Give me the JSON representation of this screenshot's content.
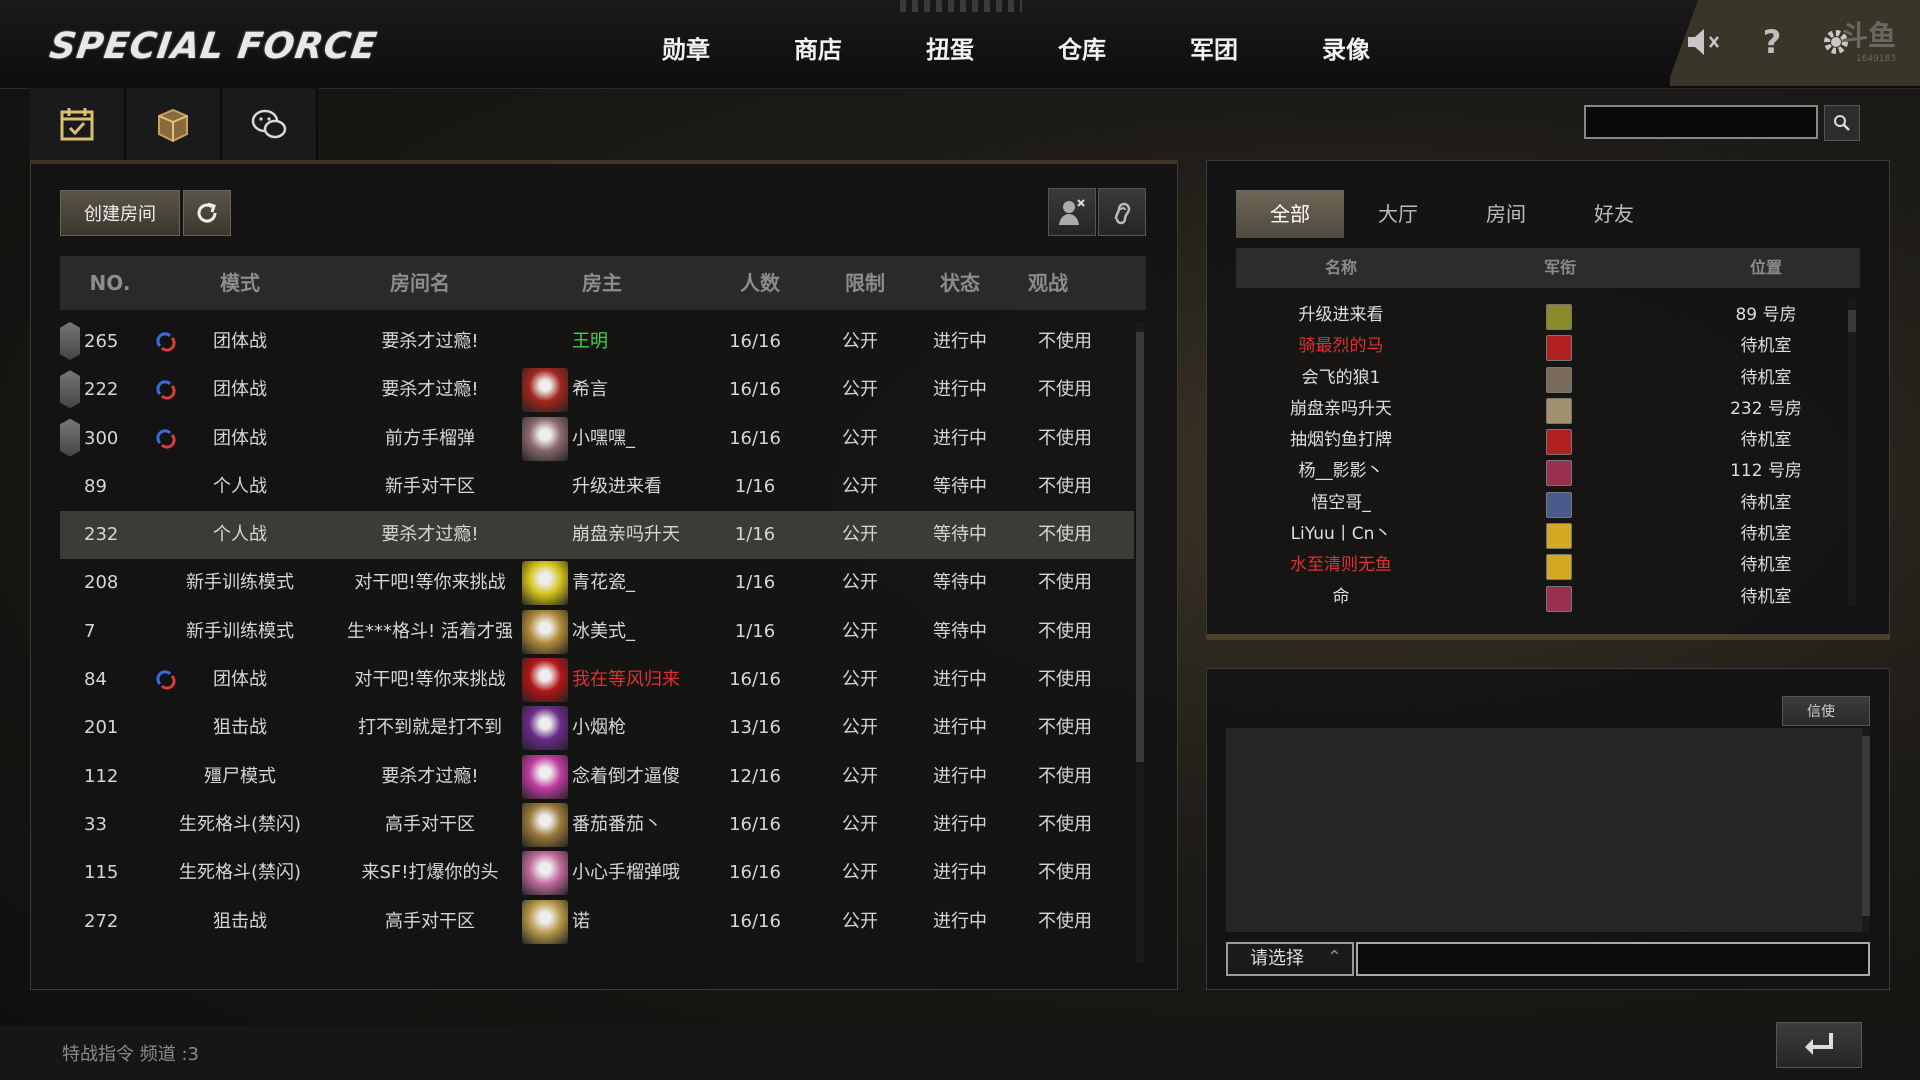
{
  "logo": "SPECIAL FORCE",
  "nav": [
    "勋章",
    "商店",
    "扭蛋",
    "仓库",
    "军团",
    "录像"
  ],
  "top_icons": [
    "speaker-muted-icon",
    "help-icon",
    "gear-icon"
  ],
  "watermark": {
    "text": "斗鱼",
    "id": "1649183"
  },
  "sub_icons": [
    "calendar-check-icon",
    "gift-box-icon",
    "wechat-icon"
  ],
  "search": {
    "value": ""
  },
  "room_panel": {
    "create_label": "创建房间",
    "headers": {
      "no": "NO.",
      "mode": "模式",
      "name": "房间名",
      "host": "房主",
      "people": "人数",
      "limit": "限制",
      "status": "状态",
      "observe": "观战"
    },
    "rows": [
      {
        "no": "265",
        "badge": true,
        "mode_icon": true,
        "mode": "团体战",
        "name": "要杀才过瘾!",
        "avatar": false,
        "host": "王明",
        "host_color": "green",
        "people": "16/16",
        "limit": "公开",
        "status": "进行中",
        "observe": "不使用"
      },
      {
        "no": "222",
        "badge": true,
        "mode_icon": true,
        "mode": "团体战",
        "name": "要杀才过瘾!",
        "avatar": "#a0261c",
        "host": "希言",
        "host_color": "",
        "people": "16/16",
        "limit": "公开",
        "status": "进行中",
        "observe": "不使用"
      },
      {
        "no": "300",
        "badge": true,
        "mode_icon": true,
        "mode": "团体战",
        "name": "前方手榴弹",
        "avatar": "#8a6a70",
        "host": "小嘿嘿_",
        "host_color": "",
        "people": "16/16",
        "limit": "公开",
        "status": "进行中",
        "observe": "不使用"
      },
      {
        "no": "89",
        "badge": false,
        "mode_icon": false,
        "mode": "个人战",
        "name": "新手对干区",
        "avatar": false,
        "host": "升级进来看",
        "host_color": "",
        "people": "1/16",
        "limit": "公开",
        "status": "等待中",
        "observe": "不使用"
      },
      {
        "no": "232",
        "badge": false,
        "mode_icon": false,
        "mode": "个人战",
        "name": "要杀才过瘾!",
        "avatar": false,
        "host": "崩盘亲吗升天",
        "host_color": "",
        "people": "1/16",
        "limit": "公开",
        "status": "等待中",
        "observe": "不使用",
        "selected": true
      },
      {
        "no": "208",
        "badge": false,
        "mode_icon": false,
        "mode": "新手训练模式",
        "name": "对干吧!等你来挑战",
        "avatar": "#d4c21a",
        "host": "青花瓷_",
        "host_color": "",
        "people": "1/16",
        "limit": "公开",
        "status": "等待中",
        "observe": "不使用"
      },
      {
        "no": "7",
        "badge": false,
        "mode_icon": false,
        "mode": "新手训练模式",
        "name": "生***格斗! 活着才强",
        "avatar": "#b08a3a",
        "host": "冰美式_",
        "host_color": "",
        "people": "1/16",
        "limit": "公开",
        "status": "等待中",
        "observe": "不使用"
      },
      {
        "no": "84",
        "badge": false,
        "mode_icon": true,
        "mode": "团体战",
        "name": "对干吧!等你来挑战",
        "avatar": "#b21616",
        "host": "我在等风归来",
        "host_color": "red",
        "people": "16/16",
        "limit": "公开",
        "status": "进行中",
        "observe": "不使用"
      },
      {
        "no": "201",
        "badge": false,
        "mode_icon": false,
        "mode": "狙击战",
        "name": "打不到就是打不到",
        "avatar": "#6a2a8a",
        "host": "小烟枪",
        "host_color": "",
        "people": "13/16",
        "limit": "公开",
        "status": "进行中",
        "observe": "不使用"
      },
      {
        "no": "112",
        "badge": false,
        "mode_icon": false,
        "mode": "殭尸模式",
        "name": "要杀才过瘾!",
        "avatar": "#c03ca0",
        "host": "念着倒才逼傻",
        "host_color": "",
        "people": "12/16",
        "limit": "公开",
        "status": "进行中",
        "observe": "不使用"
      },
      {
        "no": "33",
        "badge": false,
        "mode_icon": false,
        "mode": "生死格斗(禁闪)",
        "name": "高手对干区",
        "avatar": "#9a7a3a",
        "host": "番茄番茄丶",
        "host_color": "",
        "people": "16/16",
        "limit": "公开",
        "status": "进行中",
        "observe": "不使用"
      },
      {
        "no": "115",
        "badge": false,
        "mode_icon": false,
        "mode": "生死格斗(禁闪)",
        "name": "来SF!打爆你的头",
        "avatar": "#c06a9a",
        "host": "小心手榴弹哦",
        "host_color": "",
        "people": "16/16",
        "limit": "公开",
        "status": "进行中",
        "observe": "不使用"
      },
      {
        "no": "272",
        "badge": false,
        "mode_icon": false,
        "mode": "狙击战",
        "name": "高手对干区",
        "avatar": "#b89a4a",
        "host": "诺",
        "host_color": "",
        "people": "16/16",
        "limit": "公开",
        "status": "进行中",
        "observe": "不使用"
      }
    ]
  },
  "friends_panel": {
    "tabs": [
      "全部",
      "大厅",
      "房间",
      "好友"
    ],
    "active_tab": 0,
    "headers": {
      "name": "名称",
      "rank": "军衔",
      "location": "位置"
    },
    "rows": [
      {
        "name": "升级进来看",
        "color": "",
        "rank_color": "#8a8a2a",
        "location": "89 号房"
      },
      {
        "name": "骑最烈的马",
        "color": "red",
        "rank_color": "#b02020",
        "location": "待机室"
      },
      {
        "name": "会飞的狼1",
        "color": "",
        "rank_color": "#7a6a5a",
        "location": "待机室"
      },
      {
        "name": "崩盘亲吗升天",
        "color": "",
        "rank_color": "#a09070",
        "location": "232 号房"
      },
      {
        "name": "抽烟钓鱼打牌",
        "color": "",
        "rank_color": "#b02020",
        "location": "待机室"
      },
      {
        "name": "杨__影影丶",
        "color": "",
        "rank_color": "#9a3050",
        "location": "112 号房"
      },
      {
        "name": "悟空哥_",
        "color": "",
        "rank_color": "#4a5a8a",
        "location": "待机室"
      },
      {
        "name": "LiYuu丨Cn丶",
        "color": "",
        "rank_color": "#d4a820",
        "location": "待机室"
      },
      {
        "name": "水至清则无鱼",
        "color": "red",
        "rank_color": "#d4a820",
        "location": "待机室"
      },
      {
        "name": "命",
        "color": "",
        "rank_color": "#9a3050",
        "location": "待机室"
      }
    ]
  },
  "chat": {
    "letter_label": "信使",
    "select_label": "请选择",
    "input_value": ""
  },
  "footer": {
    "text": "特战指令   频道 :3"
  }
}
